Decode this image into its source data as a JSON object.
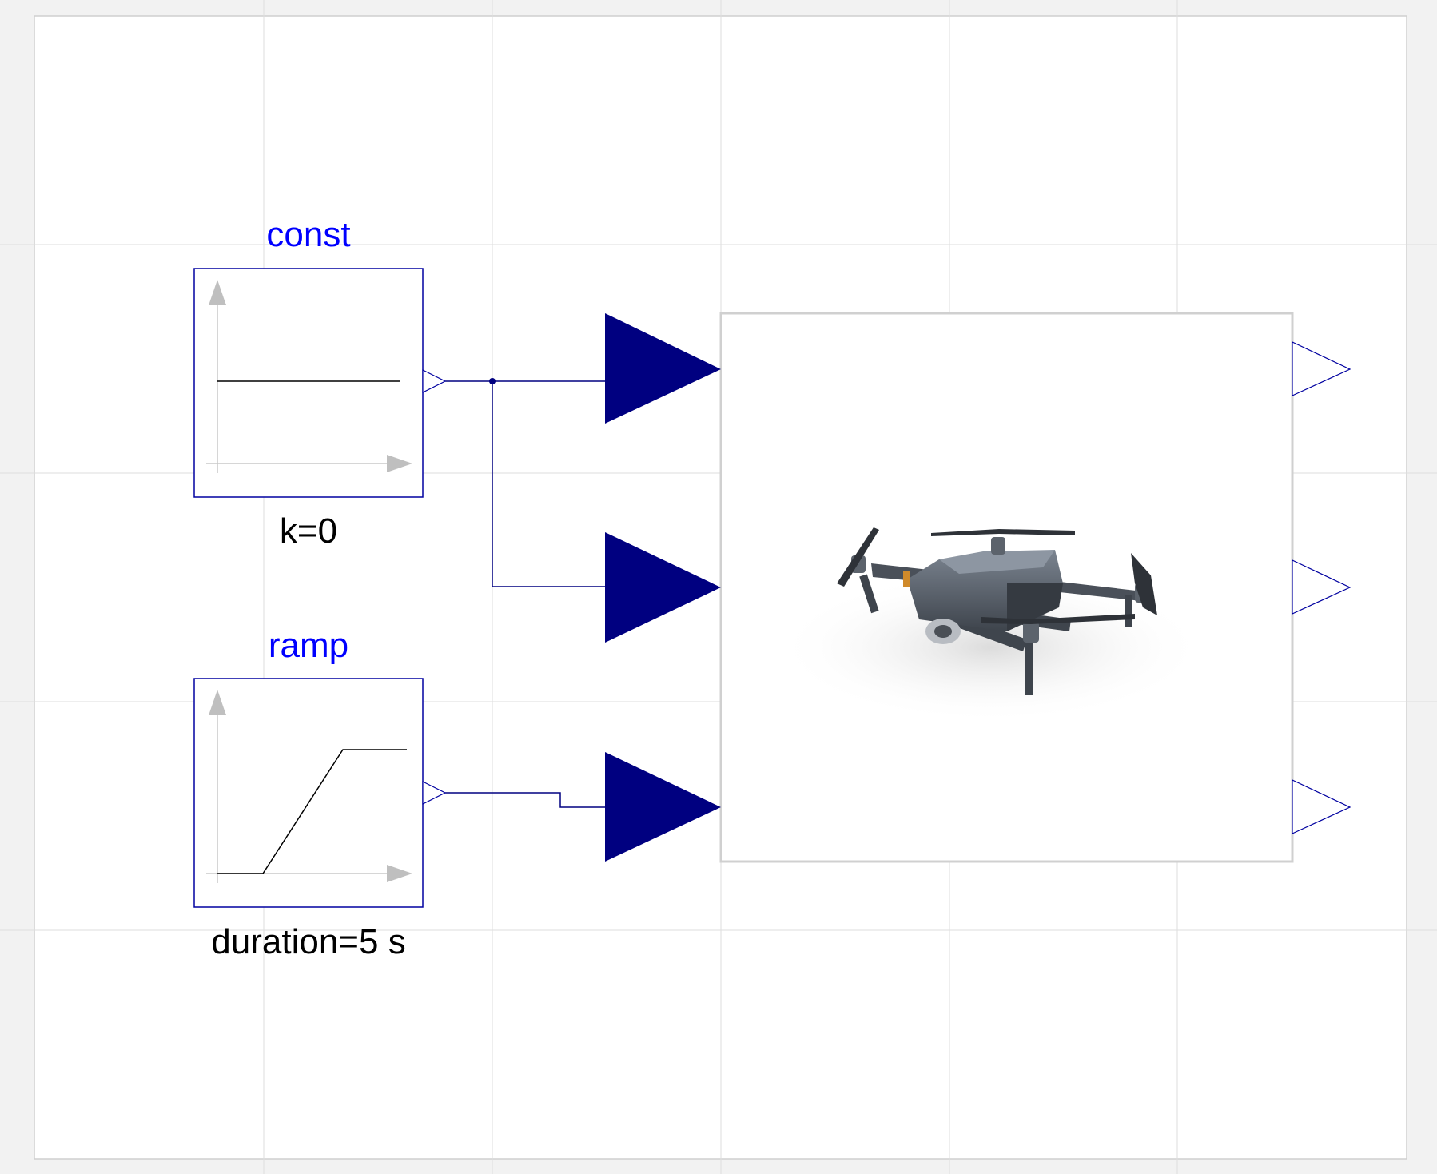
{
  "diagram": {
    "blocks": [
      {
        "id": "const",
        "name": "const",
        "parameter": "k=0"
      },
      {
        "id": "ramp",
        "name": "ramp",
        "parameter": "duration=5 s"
      }
    ],
    "drone_model": {
      "image": "quadcopter drone",
      "inputs": 3,
      "outputs": 3
    }
  },
  "colors": {
    "background": "#f2f2f2",
    "canvas": "#ffffff",
    "grid": "#dcdcdc",
    "block_border": "#0000a0",
    "block_name": "#0000ff",
    "param_text": "#000000",
    "connector": "#000080",
    "wire": "#000080",
    "axis_arrow": "#bfbfbf",
    "model_border": "#d0d0d0"
  }
}
